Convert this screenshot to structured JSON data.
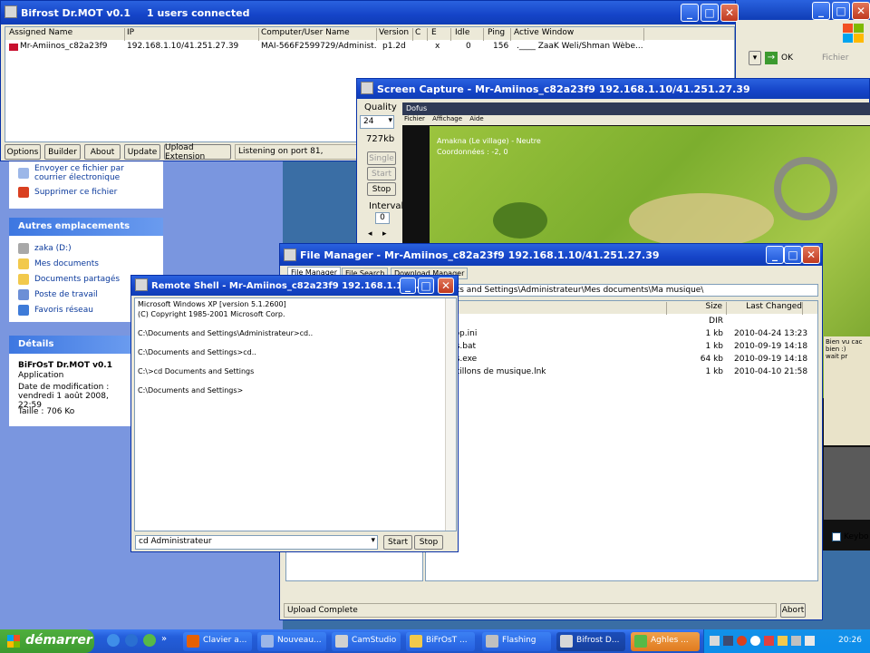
{
  "bifrost": {
    "title": "Bifrost Dr.MOT v0.1",
    "users": "1 users connected",
    "columns": [
      "Assigned Name",
      "IP",
      "Computer/User Name",
      "Version",
      "C",
      "E",
      "Idle",
      "Ping",
      "Active Window"
    ],
    "row": {
      "name": "Mr-Amiinos_c82a23f9",
      "ip": "192.168.1.10/41.251.27.39",
      "computer": "MAI-566F2599729/Administ...",
      "version": "p1.2d",
      "c": "",
      "e": "x",
      "idle": "0",
      "ping": "156",
      "window": ".____ ZaaK Weli/Shman  Wèbe..."
    },
    "buttons": [
      "Options",
      "Builder",
      "About",
      "Update",
      "Upload Extension"
    ],
    "status": "Listening on port 81,"
  },
  "explorer_panel": {
    "tasks": [
      "Envoyer ce fichier par courrier électronique",
      "Supprimer ce fichier"
    ],
    "other_places_title": "Autres emplacements",
    "other_places": [
      "zaka (D:)",
      "Mes documents",
      "Documents partagés",
      "Poste de travail",
      "Favoris réseau"
    ],
    "details_title": "Détails",
    "details_name": "BiFrOsT Dr.MOT v0.1",
    "details_type": "Application",
    "details_date": "Date de modification : vendredi 1 août 2008, 22:59",
    "details_size": "Taille : 706 Ko"
  },
  "right_window": {
    "ok": "OK",
    "fichier": "Fichier",
    "chat_line1": "Bien vu cac",
    "chat_line2": "bien :)",
    "chat_line3": "wait pr",
    "keyboard_label": "Keybo"
  },
  "screen_capture": {
    "title": "Screen Capture - Mr-Amiinos_c82a23f9 192.168.1.10/41.251.27.39",
    "quality_label": "Quality",
    "quality_value": "24",
    "size": "727kb",
    "single": "Single",
    "start": "Start",
    "stop": "Stop",
    "interval_label": "Interval",
    "interval_value": "0",
    "game_title": "Dofus",
    "game_menu": [
      "Fichier",
      "Affichage",
      "Aide"
    ],
    "game_overlay1": "Amakna (Le village) - Neutre",
    "game_overlay2": "Coordonnées : -2, 0"
  },
  "file_manager": {
    "title": "File Manager - Mr-Amiinos_c82a23f9 192.168.1.10/41.251.27.39",
    "tabs": [
      "File Manager",
      "File Search",
      "Download Manager"
    ],
    "path": "cuments and Settings\\Administrateur\\Mes documents\\Ma musique\\",
    "columns": [
      "Size",
      "Last Changed"
    ],
    "files": [
      {
        "name": "",
        "size": "DIR",
        "date": ""
      },
      {
        "name": "top.ini",
        "size": "1 kb",
        "date": "2010-04-24 13:23"
      },
      {
        "name": "ss.bat",
        "size": "1 kb",
        "date": "2010-09-19 14:18"
      },
      {
        "name": "ss.exe",
        "size": "64 kb",
        "date": "2010-09-19 14:18"
      },
      {
        "name": "ntillons de musique.lnk",
        "size": "1 kb",
        "date": "2010-04-10 21:58"
      }
    ],
    "status": "Upload Complete",
    "abort": "Abort"
  },
  "remote_shell": {
    "title": "Remote Shell - Mr-Amiinos_c82a23f9 192.168.1.10...",
    "lines": [
      "Microsoft Windows XP [version 5.1.2600]",
      "(C) Copyright 1985-2001 Microsoft Corp.",
      "",
      "C:\\Documents and Settings\\Administrateur>cd..",
      "",
      "C:\\Documents and Settings>cd..",
      "",
      "C:\\>cd Documents and Settings",
      "",
      "C:\\Documents and Settings>"
    ],
    "input_value": "cd Administrateur",
    "start": "Start",
    "stop": "Stop"
  },
  "taskbar": {
    "start": "démarrer",
    "tasks": [
      "Clavier a...",
      "Nouveau...",
      "CamStudio",
      "BiFrOsT ...",
      "Flashing",
      "Bifrost D...",
      "Aghles ..."
    ],
    "clock": "20:26"
  },
  "colors": {
    "xp_blue": "#245edb",
    "taskbar": "#2b5fd9",
    "start_green": "#3c9a2f",
    "window_face": "#ece9d8",
    "game_grass": "#86b737"
  }
}
